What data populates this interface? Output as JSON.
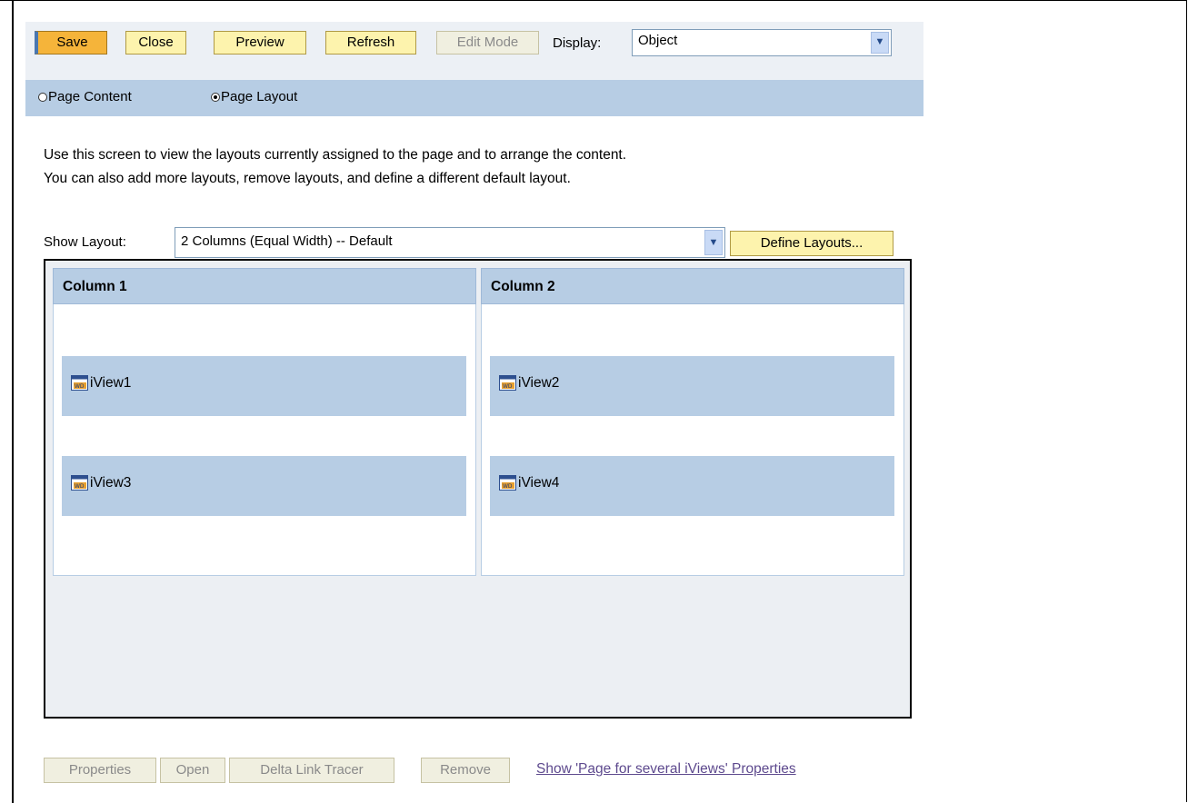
{
  "toolbar": {
    "save": "Save",
    "close": "Close",
    "preview": "Preview",
    "refresh": "Refresh",
    "edit_mode": "Edit Mode",
    "display_label": "Display:",
    "display_value": "Object"
  },
  "view_mode": {
    "page_content": "Page Content",
    "page_layout": "Page Layout",
    "selected": "Page Layout"
  },
  "description": [
    "Use this screen to view the layouts currently assigned to the page and to arrange the content.",
    "You can also add more layouts, remove layouts, and define a different default layout."
  ],
  "layout": {
    "show_label": "Show Layout:",
    "selected": "2 Columns (Equal Width) -- Default",
    "define_button": "Define Layouts...",
    "columns": [
      {
        "title": "Column 1",
        "iviews": [
          "iView1",
          "iView3"
        ]
      },
      {
        "title": "Column 2",
        "iviews": [
          "iView2",
          "iView4"
        ]
      }
    ]
  },
  "actions": {
    "properties": "Properties",
    "open": "Open",
    "delta_link_tracer": "Delta Link Tracer",
    "remove": "Remove",
    "show_page_link": "Show 'Page for several iViews' Properties"
  },
  "icons": {
    "iview": "webdynpro-iview-icon",
    "dropdown": "chevron-down-icon"
  },
  "colors": {
    "header_bg": "#b7cde4",
    "button_bg": "#fdf3ad",
    "save_bg": "#f5b43a",
    "link": "#5e4a8e"
  }
}
